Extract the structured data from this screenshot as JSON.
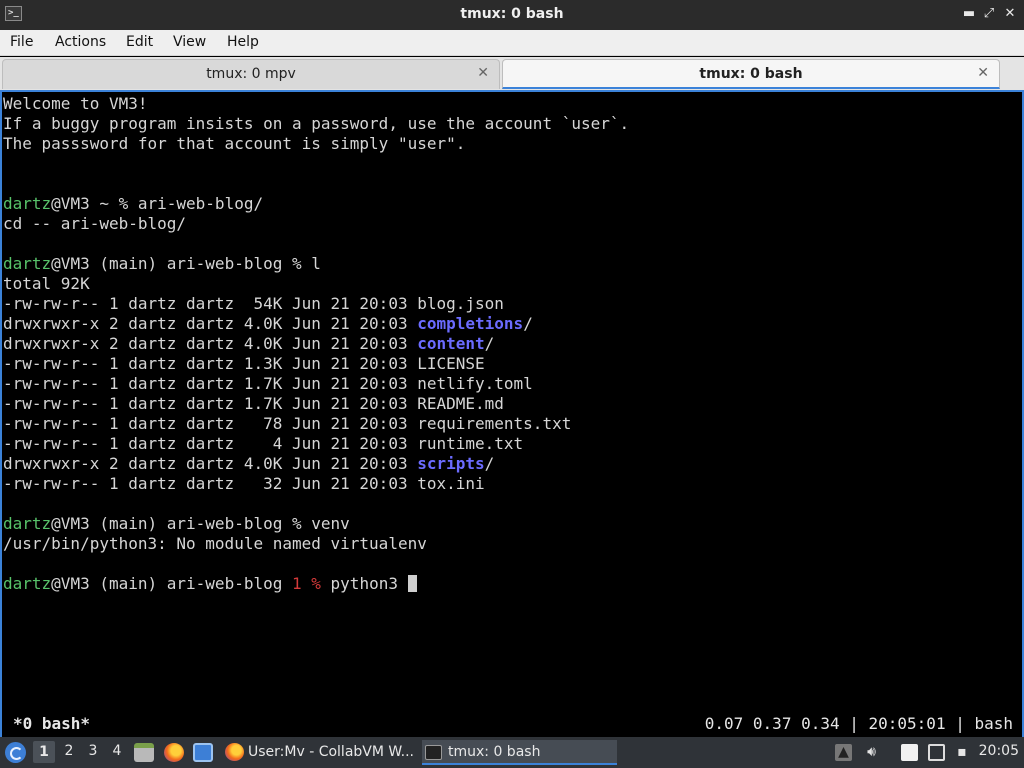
{
  "window": {
    "title": "tmux: 0 bash",
    "app_icon": "terminal-icon",
    "controls": [
      "minimize-icon",
      "restore-icon",
      "close-icon"
    ],
    "control_glyphs": [
      "▬",
      "⤢",
      "✕"
    ]
  },
  "menubar": {
    "items": [
      "File",
      "Actions",
      "Edit",
      "View",
      "Help"
    ]
  },
  "tabs": [
    {
      "label": "tmux: 0 mpv",
      "active": false,
      "close": "✕"
    },
    {
      "label": "tmux: 0 bash",
      "active": true,
      "close": "✕"
    }
  ],
  "terminal": {
    "lines": [
      {
        "segments": [
          {
            "text": "Welcome to VM3!",
            "style": "plain"
          }
        ]
      },
      {
        "segments": [
          {
            "text": "If a buggy program insists on a password, use the account `user`.",
            "style": "plain"
          }
        ]
      },
      {
        "segments": [
          {
            "text": "The passsword for that account is simply \"user\".",
            "style": "plain"
          }
        ]
      },
      {
        "segments": []
      },
      {
        "segments": []
      },
      {
        "segments": [
          {
            "text": "dartz",
            "style": "user"
          },
          {
            "text": "@VM3 ~ % ari-web-blog/",
            "style": "plain"
          }
        ]
      },
      {
        "segments": [
          {
            "text": "cd -- ari-web-blog/",
            "style": "plain"
          }
        ]
      },
      {
        "segments": []
      },
      {
        "segments": [
          {
            "text": "dartz",
            "style": "user"
          },
          {
            "text": "@VM3 (main) ari-web-blog % l",
            "style": "plain"
          }
        ]
      },
      {
        "segments": [
          {
            "text": "total 92K",
            "style": "plain"
          }
        ]
      },
      {
        "segments": [
          {
            "text": "-rw-rw-r-- 1 dartz dartz  54K Jun 21 20:03 blog.json",
            "style": "plain"
          }
        ]
      },
      {
        "segments": [
          {
            "text": "drwxrwxr-x 2 dartz dartz 4.0K Jun 21 20:03 ",
            "style": "plain"
          },
          {
            "text": "completions",
            "style": "dir"
          },
          {
            "text": "/",
            "style": "plain"
          }
        ]
      },
      {
        "segments": [
          {
            "text": "drwxrwxr-x 2 dartz dartz 4.0K Jun 21 20:03 ",
            "style": "plain"
          },
          {
            "text": "content",
            "style": "dir"
          },
          {
            "text": "/",
            "style": "plain"
          }
        ]
      },
      {
        "segments": [
          {
            "text": "-rw-rw-r-- 1 dartz dartz 1.3K Jun 21 20:03 LICENSE",
            "style": "plain"
          }
        ]
      },
      {
        "segments": [
          {
            "text": "-rw-rw-r-- 1 dartz dartz 1.7K Jun 21 20:03 netlify.toml",
            "style": "plain"
          }
        ]
      },
      {
        "segments": [
          {
            "text": "-rw-rw-r-- 1 dartz dartz 1.7K Jun 21 20:03 README.md",
            "style": "plain"
          }
        ]
      },
      {
        "segments": [
          {
            "text": "-rw-rw-r-- 1 dartz dartz   78 Jun 21 20:03 requirements.txt",
            "style": "plain"
          }
        ]
      },
      {
        "segments": [
          {
            "text": "-rw-rw-r-- 1 dartz dartz    4 Jun 21 20:03 runtime.txt",
            "style": "plain"
          }
        ]
      },
      {
        "segments": [
          {
            "text": "drwxrwxr-x 2 dartz dartz 4.0K Jun 21 20:03 ",
            "style": "plain"
          },
          {
            "text": "scripts",
            "style": "dir"
          },
          {
            "text": "/",
            "style": "plain"
          }
        ]
      },
      {
        "segments": [
          {
            "text": "-rw-rw-r-- 1 dartz dartz   32 Jun 21 20:03 tox.ini",
            "style": "plain"
          }
        ]
      },
      {
        "segments": []
      },
      {
        "segments": [
          {
            "text": "dartz",
            "style": "user"
          },
          {
            "text": "@VM3 (main) ari-web-blog % venv",
            "style": "plain"
          }
        ]
      },
      {
        "segments": [
          {
            "text": "/usr/bin/python3: No module named virtualenv",
            "style": "plain"
          }
        ]
      },
      {
        "segments": []
      },
      {
        "segments": [
          {
            "text": "dartz",
            "style": "user"
          },
          {
            "text": "@VM3 (main) ari-web-blog ",
            "style": "plain"
          },
          {
            "text": "1 %",
            "style": "err"
          },
          {
            "text": " python3 ",
            "style": "plain"
          }
        ],
        "cursor": true
      }
    ]
  },
  "tmux_status": {
    "window": "*0 bash*",
    "right": "0.07 0.37 0.34 | 20:05:01 | bash"
  },
  "taskbar": {
    "menu_icon": "start-menu-icon",
    "workspaces": [
      "1",
      "2",
      "3",
      "4"
    ],
    "active_workspace": "1",
    "quick_launch": [
      "file-manager-icon",
      "firefox-icon",
      "show-desktop-icon"
    ],
    "tasks": [
      {
        "label": "User:Mv - CollabVM W...",
        "icon": "firefox-icon"
      },
      {
        "label": "tmux: 0 bash",
        "icon": "terminal-icon"
      }
    ],
    "tray": [
      "upload-icon",
      "volume-icon",
      "clipboard-icon",
      "network-icon"
    ],
    "clock": "20:05",
    "colors": {
      "accent": "#3b82d9",
      "prompt_user": "#58c36a",
      "directory": "#6b6bff",
      "error": "#d43a3a"
    }
  }
}
